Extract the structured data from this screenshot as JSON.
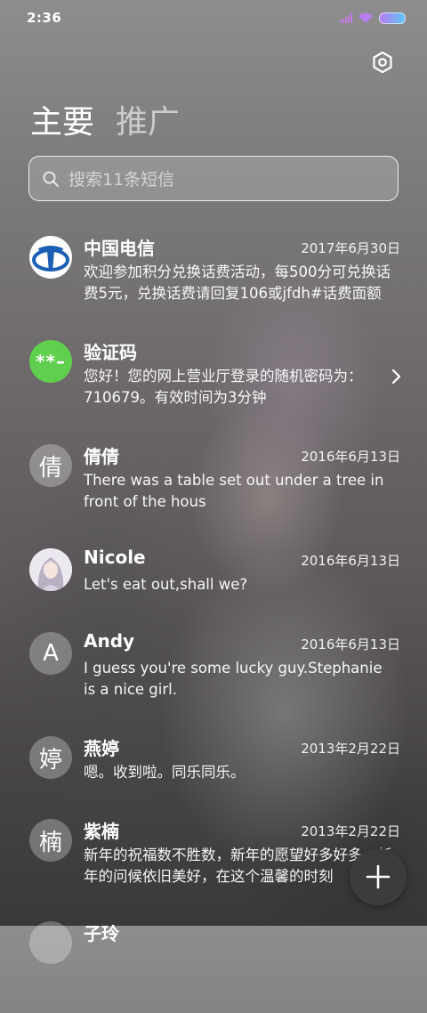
{
  "status": {
    "time": "2:36"
  },
  "tabs": [
    {
      "label": "主要"
    },
    {
      "label": "推广"
    }
  ],
  "search": {
    "placeholder": "搜索11条短信"
  },
  "conversations": [
    {
      "name": "中国电信",
      "date": "2017年6月30日",
      "preview": "欢迎参加积分兑换话费活动，每500分可兑换话费5元，兑换话费请回复106或jfdh#话费面额",
      "avatar_type": "china-telecom-logo"
    },
    {
      "name": "验证码",
      "date": "",
      "preview": "您好！您的网上营业厅登录的随机密码为：710679。有效时间为3分钟",
      "avatar_text": "**–"
    },
    {
      "name": "倩倩",
      "date": "2016年6月13日",
      "preview": "There was a table set out under a tree in front of the hous",
      "avatar_text": "倩"
    },
    {
      "name": "Nicole",
      "date": "2016年6月13日",
      "preview": "Let's eat out,shall we?",
      "avatar_type": "photo"
    },
    {
      "name": "Andy",
      "date": "2016年6月13日",
      "preview": "I guess you're some lucky guy.Stephanie is a nice girl.",
      "avatar_text": "A"
    },
    {
      "name": "燕婷",
      "date": "2013年2月22日",
      "preview": "嗯。收到啦。同乐同乐。",
      "avatar_text": "婷"
    },
    {
      "name": "紫楠",
      "date": "2013年2月22日",
      "preview": "新年的祝福数不胜数，新年的愿望好多好多，新年的问候依旧美好，在这个温馨的时刻",
      "avatar_text": "楠"
    },
    {
      "name": "子玲",
      "date": "",
      "preview": "",
      "avatar_text": ""
    }
  ],
  "colors": {
    "telecom_blue": "#1a5fb4",
    "verify_green": "#5fcf4d",
    "fab_bg": "#3c3c3c"
  },
  "icons": {
    "settings": "gear-icon",
    "search": "search-icon",
    "compose": "plus-icon",
    "chevron": "chevron-right-icon"
  }
}
